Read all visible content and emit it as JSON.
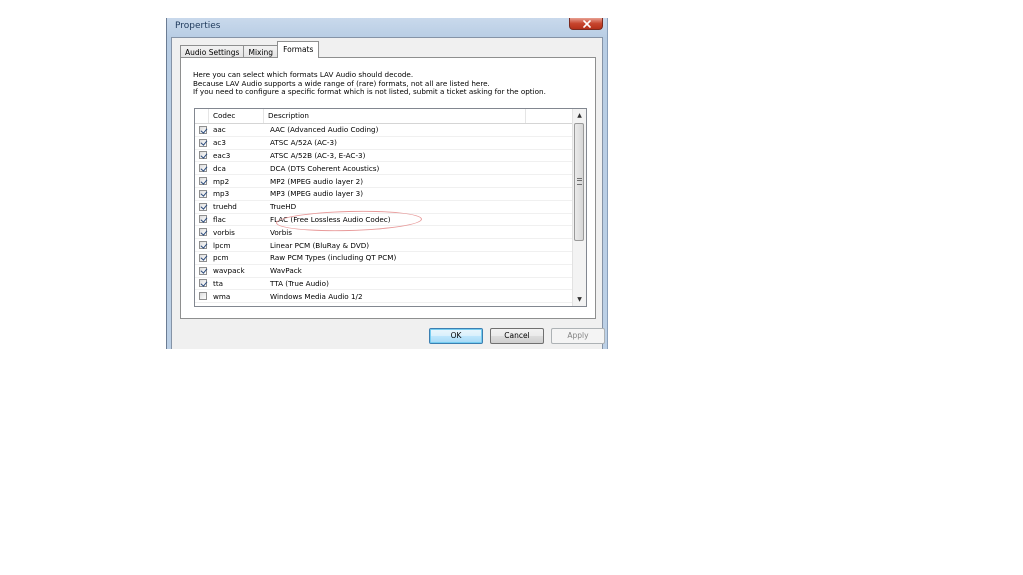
{
  "window": {
    "title": "Properties"
  },
  "tabs": [
    {
      "label": "Audio Settings",
      "active": false
    },
    {
      "label": "Mixing",
      "active": false
    },
    {
      "label": "Formats",
      "active": true
    }
  ],
  "description": {
    "line1": "Here you can select which formats LAV Audio should decode.",
    "line2": "Because LAV Audio supports a wide range of (rare) formats, not all are listed here.",
    "line3": "If you need to configure a specific format which is not listed, submit a ticket asking for the option."
  },
  "list": {
    "headers": {
      "codec": "Codec",
      "description": "Description"
    },
    "rows": [
      {
        "checked": true,
        "codec": "aac",
        "description": "AAC (Advanced Audio Coding)"
      },
      {
        "checked": true,
        "codec": "ac3",
        "description": "ATSC A/52A (AC-3)"
      },
      {
        "checked": true,
        "codec": "eac3",
        "description": "ATSC A/52B (AC-3, E-AC-3)"
      },
      {
        "checked": true,
        "codec": "dca",
        "description": "DCA (DTS Coherent Acoustics)"
      },
      {
        "checked": true,
        "codec": "mp2",
        "description": "MP2 (MPEG audio layer 2)"
      },
      {
        "checked": true,
        "codec": "mp3",
        "description": "MP3 (MPEG audio layer 3)"
      },
      {
        "checked": true,
        "codec": "truehd",
        "description": "TrueHD"
      },
      {
        "checked": true,
        "codec": "flac",
        "description": "FLAC (Free Lossless Audio Codec)"
      },
      {
        "checked": true,
        "codec": "vorbis",
        "description": "Vorbis"
      },
      {
        "checked": true,
        "codec": "lpcm",
        "description": "Linear PCM (BluRay & DVD)"
      },
      {
        "checked": true,
        "codec": "pcm",
        "description": "Raw PCM Types (including QT PCM)"
      },
      {
        "checked": true,
        "codec": "wavpack",
        "description": "WavPack"
      },
      {
        "checked": true,
        "codec": "tta",
        "description": "TTA (True Audio)"
      },
      {
        "checked": false,
        "codec": "wma",
        "description": "Windows Media Audio 1/2"
      }
    ]
  },
  "buttons": {
    "ok": "OK",
    "cancel": "Cancel",
    "apply": "Apply"
  },
  "icons": {
    "close": "close-icon",
    "scroll_up": "chevron-up-icon",
    "scroll_down": "chevron-down-icon",
    "check": "checkmark-icon"
  },
  "colors": {
    "title_text": "#1e395b",
    "close_button": "#c7452d",
    "highlight_annotation": "#e89a9a",
    "default_button_border": "#3c7fb1"
  }
}
